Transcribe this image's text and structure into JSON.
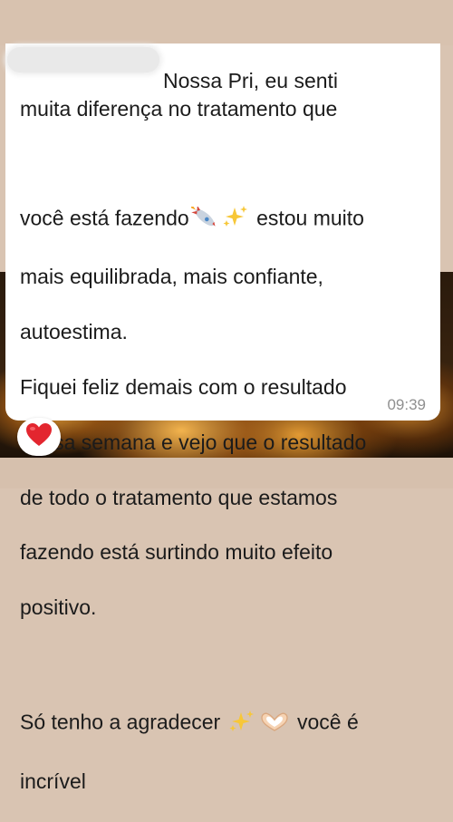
{
  "message": {
    "line1": "Nossa Pri, eu senti",
    "line2": "muita diferença no tratamento que",
    "line3_a": "você está fazendo",
    "line3_b": " estou muito",
    "line4": "mais equilibrada, mais confiante,",
    "line5": "autoestima.",
    "line6": "Fiquei feliz demais com o resultado",
    "line7": "dessa semana e vejo que o resultado",
    "line8": "de todo o tratamento que estamos",
    "line9": "fazendo está surtindo muito efeito",
    "line10": "positivo.",
    "line11_a": "Só tenho a agradecer ",
    "line11_b": " você é",
    "line12": "incrível",
    "time": "09:39",
    "emojis": [
      "rocket-emoji",
      "sparkles-emoji",
      "sparkles-emoji",
      "heart-hands-emoji"
    ]
  },
  "reaction": {
    "icon": "red-heart-icon",
    "color": "#e3262f"
  }
}
